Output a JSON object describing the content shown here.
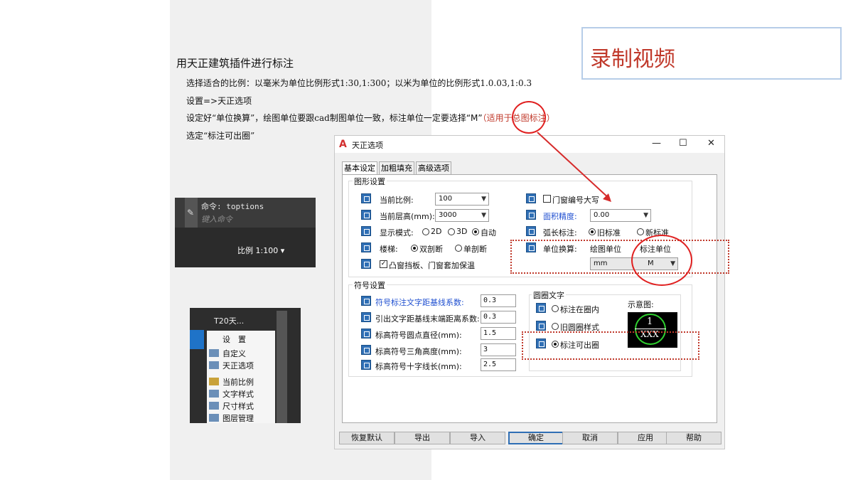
{
  "slide": {
    "title": "用天正建筑插件进行标注",
    "lines": [
      "选择适合的比例：以毫米为单位比例形式1:30,1:300；以米为单位的比例形式1.0.03,1:0.3",
      "设置=>天正选项",
      "设定好“单位换算”，绘图单位要跟cad制图单位一致，标注单位一定要选择",
      "选定“标注可出圈”"
    ],
    "highlight_char": "“M”",
    "red_note": "（适用于总图标注）",
    "record_label": "录制视频"
  },
  "shot1": {
    "cmd": "命令: toptions",
    "placeholder": "键入命令",
    "scale": "比例 1:100 ▾"
  },
  "shot2": {
    "app": "T20天...",
    "items": [
      "设　置",
      "自定义",
      "天正选项",
      "当前比例",
      "文字样式",
      "尺寸样式",
      "图层管理"
    ]
  },
  "dialog": {
    "title": "天正选项",
    "tabs": [
      "基本设定",
      "加粗填充",
      "高级选项"
    ],
    "group_graphic": "图形设置",
    "scale_label": "当前比例:",
    "scale_value": "100",
    "height_label": "当前层高(mm):",
    "height_value": "3000",
    "display_label": "显示模式:",
    "display_opts": [
      "2D",
      "3D",
      "自动"
    ],
    "stair_label": "楼梯:",
    "stair_opts": [
      "双剖断",
      "单剖断"
    ],
    "window_insul": "凸窗挡板、门窗套加保温",
    "door_upper": "门窗编号大写",
    "area_label": "面积精度:",
    "area_value": "0.00",
    "arc_label": "弧长标注:",
    "arc_opts": [
      "旧标准",
      "新标准"
    ],
    "unit_label": "单位换算:",
    "draw_unit_label": "绘图单位",
    "mark_unit_label": "标注单位",
    "draw_unit_value": "mm",
    "mark_unit_value": "M",
    "group_symbol": "符号设置",
    "symbol_rows": [
      {
        "label": "符号标注文字距基线系数:",
        "value": "0.3"
      },
      {
        "label": "引出文字距基线末端距离系数:",
        "value": "0.3"
      },
      {
        "label": "标高符号圆点直径(mm):",
        "value": "1.5"
      },
      {
        "label": "标高符号三角高度(mm):",
        "value": "3"
      },
      {
        "label": "标高符号十字线长(mm):",
        "value": "2.5"
      }
    ],
    "group_circle": "圆圈文字",
    "circle_opts": [
      "标注在圈内",
      "旧圆圈样式",
      "标注可出圈"
    ],
    "preview_label": "示意图:",
    "preview_top": "1",
    "preview_bottom": "XXX",
    "buttons": [
      "恢复默认",
      "导出",
      "导入",
      "确定",
      "取消",
      "应用",
      "帮助"
    ]
  },
  "colors": {
    "accent_red": "#c0392b",
    "dialog_blue": "#2f6fb5"
  }
}
